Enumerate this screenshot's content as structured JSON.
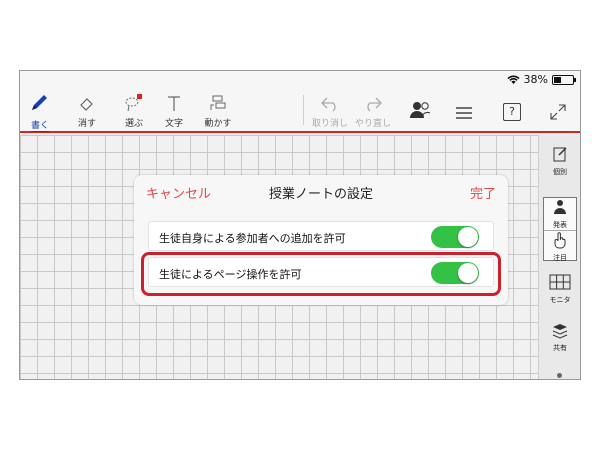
{
  "status": {
    "battery": "38%",
    "battery_level": 0.38
  },
  "toolbar": {
    "write": "書く",
    "erase": "消す",
    "select": "選ぶ",
    "text": "文字",
    "move": "動かす",
    "undo": "取り消し",
    "redo": "やり直し",
    "help": "?"
  },
  "rightbar": {
    "individual": "個別",
    "present": "発表",
    "attention": "注目",
    "monitor": "モニタ",
    "share": "共有"
  },
  "dialog": {
    "cancel": "キャンセル",
    "title": "授業ノートの設定",
    "done": "完了",
    "settings": [
      {
        "label": "生徒自身による参加者への追加を許可",
        "enabled": true
      },
      {
        "label": "生徒によるページ操作を許可",
        "enabled": true
      }
    ]
  },
  "colors": {
    "accent_red": "#e34747",
    "toggle_green": "#33c146",
    "highlight": "#c8232c",
    "active_blue": "#1a3fb3"
  }
}
